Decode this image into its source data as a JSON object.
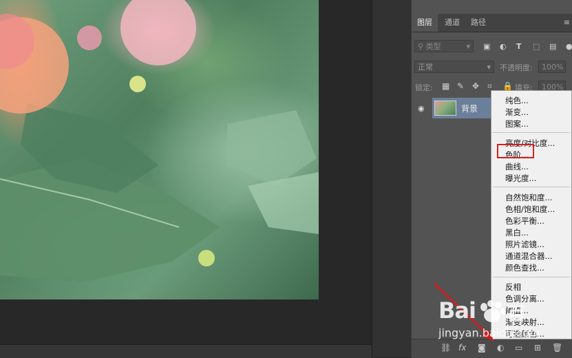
{
  "panel": {
    "tabs": [
      "图层",
      "通道",
      "路径"
    ],
    "menu_icon": "hamburger-icon",
    "filter": {
      "label": "类型",
      "icons": [
        "image-icon",
        "circle-half-icon",
        "text-icon",
        "shape-icon",
        "smart-object-icon"
      ]
    },
    "blend_mode": "正常",
    "opacity_label": "不透明度:",
    "opacity_value": "100%",
    "lock_label": "锁定:",
    "fill_label": "填充:",
    "fill_value": "100%",
    "layer": {
      "name": "背景",
      "visible": true
    }
  },
  "menu": {
    "groups": [
      [
        "纯色...",
        "渐变...",
        "图案..."
      ],
      [
        "亮度/对比度...",
        "色阶...",
        "曲线...",
        "曝光度..."
      ],
      [
        "自然饱和度...",
        "色相/饱和度...",
        "色彩平衡...",
        "黑白...",
        "照片滤镜...",
        "通道混合器...",
        "颜色查找..."
      ],
      [
        "反相",
        "色调分离...",
        "阈值...",
        "渐变映射...",
        "可选颜色..."
      ]
    ],
    "highlighted_item": "色阶..."
  },
  "footer_icons": [
    "link-icon",
    "fx-icon",
    "mask-icon",
    "adjustment-layer-icon",
    "folder-icon",
    "new-layer-icon",
    "trash-icon"
  ],
  "watermark": {
    "logo": "Bai",
    "logo_suffix": "百",
    "subtitle": "jingyan.baidu.com"
  },
  "colors": {
    "highlight": "#d21f1f",
    "layer_selected": "#6c7f9a",
    "panel_bg": "#535353",
    "arrow": "#cc2020"
  }
}
